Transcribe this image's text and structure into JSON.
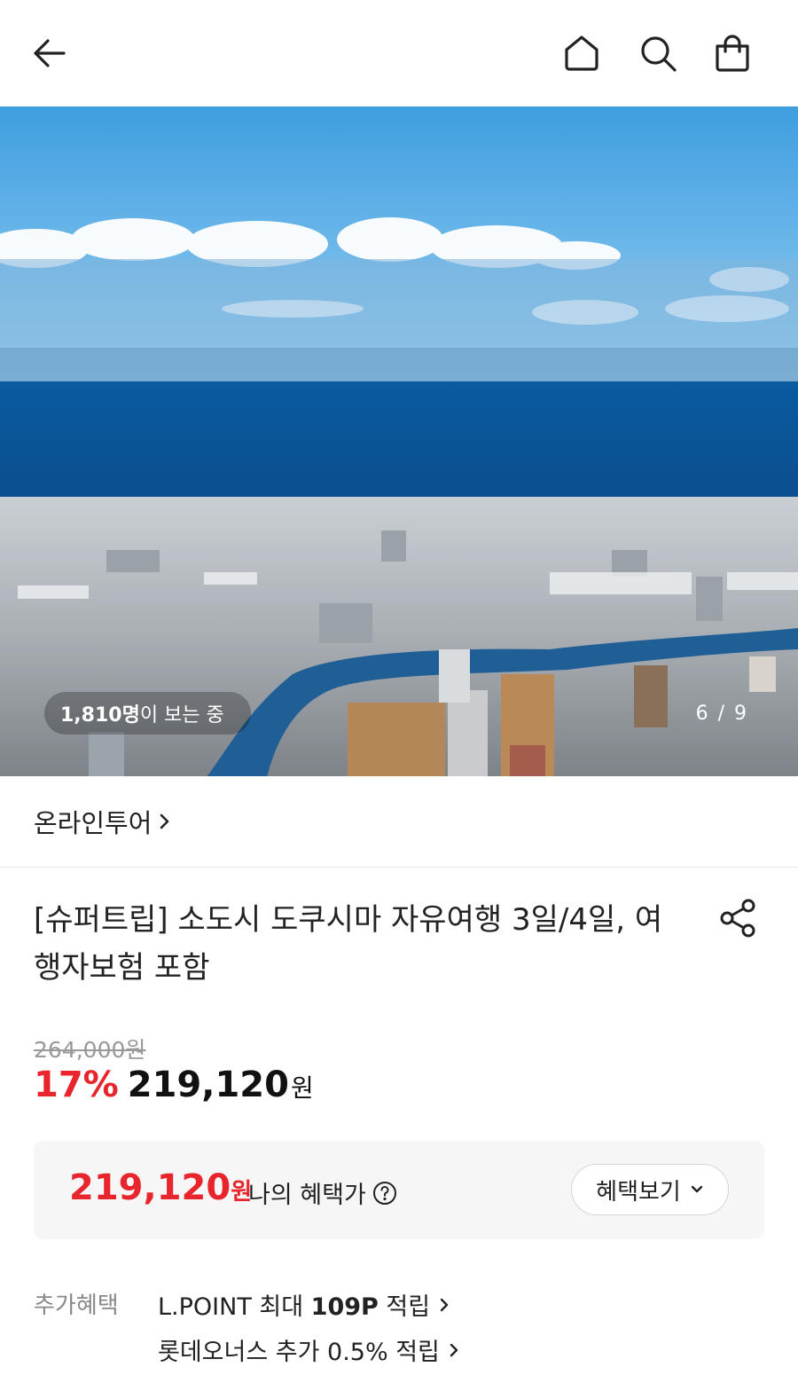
{
  "hero": {
    "viewers_count": "1,810명",
    "viewers_suffix": "이 보는 중",
    "pager": "6 / 9"
  },
  "seller": {
    "name": "온라인투어"
  },
  "product": {
    "title": "[슈퍼트립] 소도시 도쿠시마 자유여행 3일/4일, 여행자보험 포함",
    "original_price": "264,000원",
    "discount_rate": "17%",
    "sale_price": "219,120",
    "currency": "원"
  },
  "benefit": {
    "price": "219,120",
    "currency": "원",
    "label": "나의 혜택가",
    "button": "혜택보기"
  },
  "extra": {
    "label": "추가혜택",
    "items": [
      {
        "prefix": "L.POINT 최대 ",
        "bold": "109P",
        "suffix": " 적립"
      },
      {
        "prefix": "롯데오너스 추가 0.5% 적립",
        "bold": "",
        "suffix": ""
      }
    ]
  },
  "colors": {
    "accent": "#e8242d",
    "muted": "#999999",
    "box_bg": "#f6f6f6"
  }
}
